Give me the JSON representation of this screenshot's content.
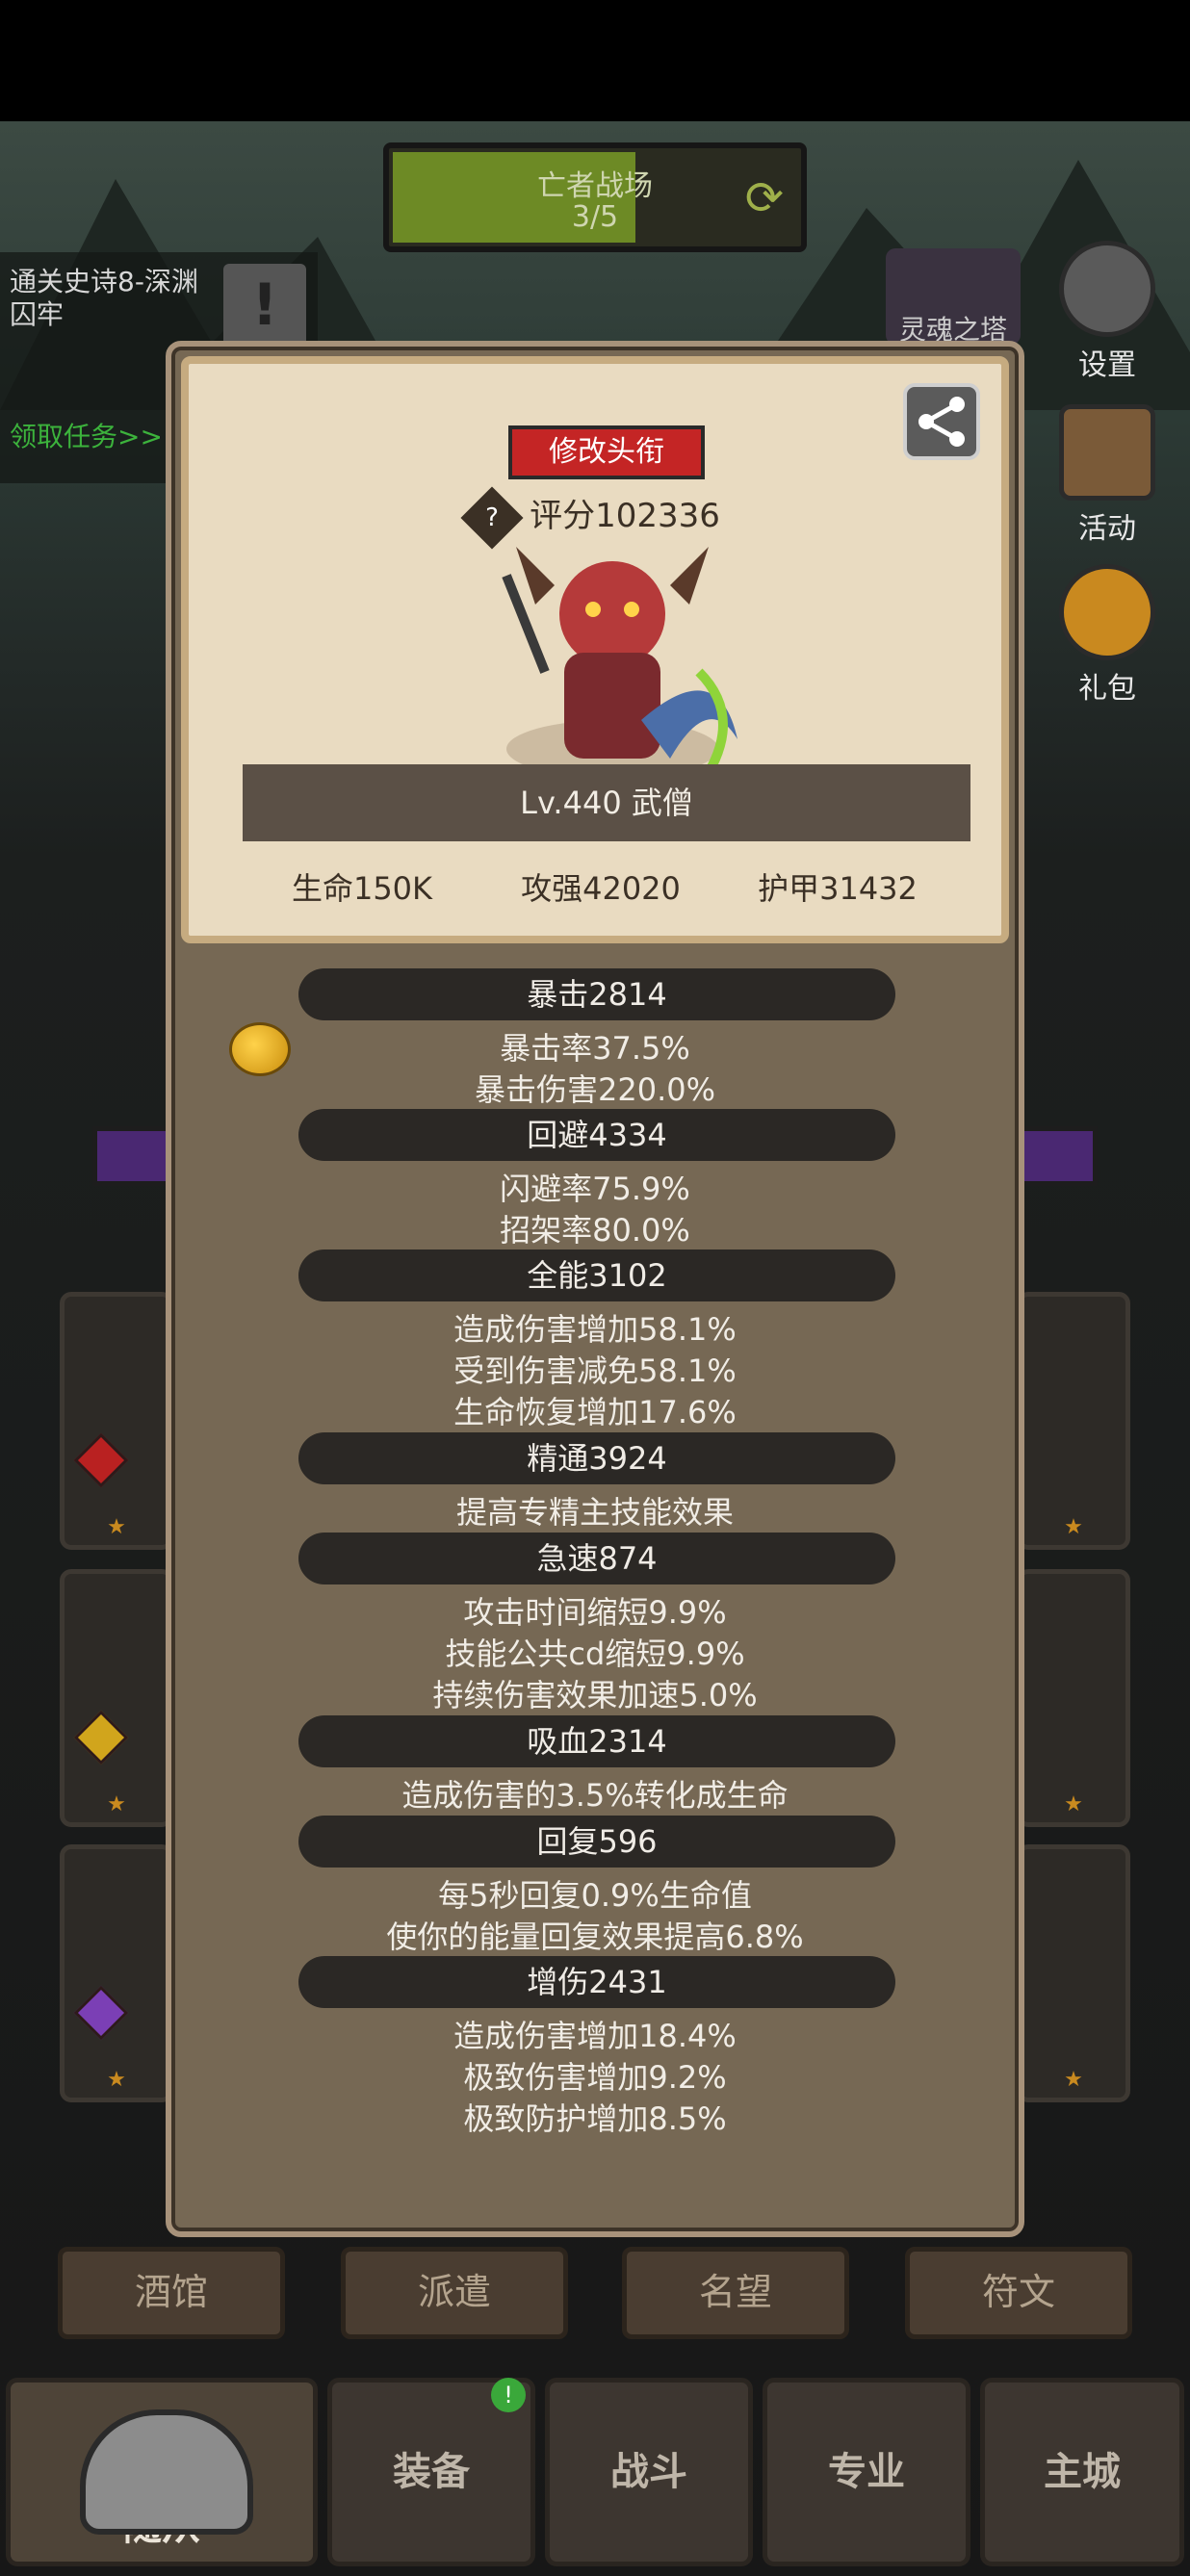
{
  "top_battle": {
    "name": "亡者战场",
    "progress_text": "3/5",
    "progress": 0.6
  },
  "quest": {
    "text": "通关史诗8-深渊囚牢",
    "claim": "领取任务>>"
  },
  "side_buttons": {
    "soul_tower": "灵魂之塔",
    "settings": "设置",
    "activity": "活动",
    "gift": "礼包"
  },
  "popup": {
    "change_title_button": "修改头衔",
    "score_help_icon": "?",
    "score": "评分102336",
    "level_name": "Lv.440 武僧",
    "stats": {
      "hp": "生命150K",
      "attack": "攻强42020",
      "armor": "护甲31432"
    },
    "attributes": [
      {
        "header": "暴击2814",
        "lines": [
          "暴击率37.5%",
          "暴击伤害220.0%"
        ]
      },
      {
        "header": "回避4334",
        "lines": [
          "闪避率75.9%",
          "招架率80.0%"
        ]
      },
      {
        "header": "全能3102",
        "lines": [
          "造成伤害增加58.1%",
          "受到伤害减免58.1%",
          "生命恢复增加17.6%"
        ]
      },
      {
        "header": "精通3924",
        "lines": [
          "提高专精主技能效果"
        ]
      },
      {
        "header": "急速874",
        "lines": [
          "攻击时间缩短9.9%",
          "技能公共cd缩短9.9%",
          "持续伤害效果加速5.0%"
        ]
      },
      {
        "header": "吸血2314",
        "lines": [
          "造成伤害的3.5%转化成生命"
        ]
      },
      {
        "header": "回复596",
        "lines": [
          "每5秒回复0.9%生命值",
          "使你的能量回复效果提高6.8%"
        ]
      },
      {
        "header": "增伤2431",
        "lines": [
          "造成伤害增加18.4%",
          "极致伤害增加9.2%",
          "极致防护增加8.5%"
        ]
      }
    ]
  },
  "tabs": [
    "酒馆",
    "派遣",
    "名望",
    "符文"
  ],
  "nav": {
    "follower": "随从",
    "equipment": "装备",
    "battle": "战斗",
    "profession": "专业",
    "main_city": "主城",
    "badge": "!"
  },
  "colors": {
    "popup_bg": "#766854",
    "parchment": "#e9dbc1",
    "title_button": "#c42525",
    "attr_header": "#2b2825"
  }
}
